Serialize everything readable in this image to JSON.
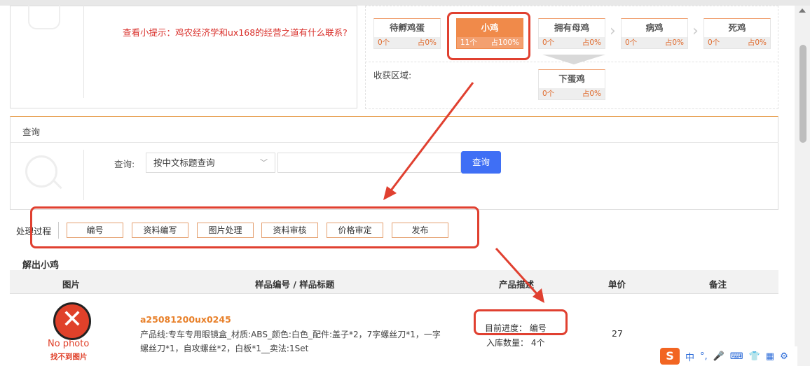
{
  "tip": "查看小提示：鸡农经济学和ux168的经营之道有什么联系?",
  "stages": [
    {
      "name": "待孵鸡蛋",
      "count": "0个",
      "pct": "占0%"
    },
    {
      "name": "小鸡",
      "count": "11个",
      "pct": "占100%"
    },
    {
      "name": "拥有母鸡",
      "count": "0个",
      "pct": "占0%"
    },
    {
      "name": "病鸡",
      "count": "0个",
      "pct": "占0%"
    },
    {
      "name": "死鸡",
      "count": "0个",
      "pct": "占0%"
    }
  ],
  "harvest": {
    "label": "收获区域:",
    "stage": {
      "name": "下蛋鸡",
      "count": "0个",
      "pct": "占0%"
    }
  },
  "query": {
    "title": "查询",
    "label": "查询:",
    "select_value": "按中文标题查询",
    "button": "查询"
  },
  "process": {
    "label": "处理过程",
    "steps": [
      "编号",
      "资料编写",
      "图片处理",
      "资料审核",
      "价格审定",
      "发布"
    ]
  },
  "section_title": "解出小鸡",
  "table": {
    "headers": {
      "image": "图片",
      "sku": "样品编号 / 样品标题",
      "desc": "产品描述",
      "price": "单价",
      "note": "备注"
    },
    "row": {
      "nophoto_en": "No photo",
      "nophoto_zh": "找不到图片",
      "sku": "a25081200ux0245",
      "desc": "产品线:专车专用眼镜盒_材质:ABS_颜色:白色_配件:盖子*2，7字螺丝刀*1，一字螺丝刀*1，自攻螺丝*2，白板*1__卖法:1Set",
      "progress": "目前进度：  编号",
      "stock": "入库数量：  4个",
      "price": "27"
    }
  },
  "ime": {
    "logo": "S",
    "lang": "中"
  }
}
